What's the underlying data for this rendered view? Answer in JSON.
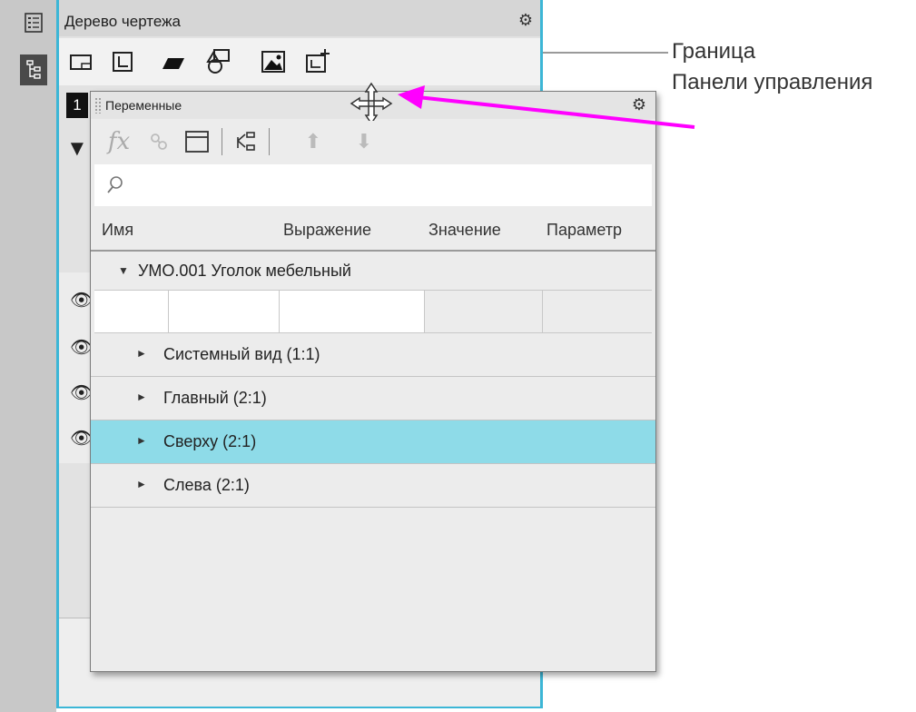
{
  "tree_panel": {
    "title": "Дерево чертежа",
    "number_box": "1"
  },
  "variables_panel": {
    "title": "Переменные",
    "search": {
      "placeholder": ""
    },
    "columns": [
      "Имя",
      "Выражение",
      "Значение",
      "Параметр"
    ],
    "root": "УМО.001 Уголок мебельный",
    "rows": [
      {
        "label": "Системный вид (1:1)",
        "selected": false
      },
      {
        "label": "Главный (2:1)",
        "selected": false
      },
      {
        "label": "Сверху (2:1)",
        "selected": true
      },
      {
        "label": "Слева (2:1)",
        "selected": false
      }
    ]
  },
  "annotation": {
    "line1": "Граница",
    "line2": "Панели управления"
  },
  "colors": {
    "panel_border": "#3cb6d6",
    "selected_row": "#8edbe8",
    "arrow": "#ff00ff"
  }
}
